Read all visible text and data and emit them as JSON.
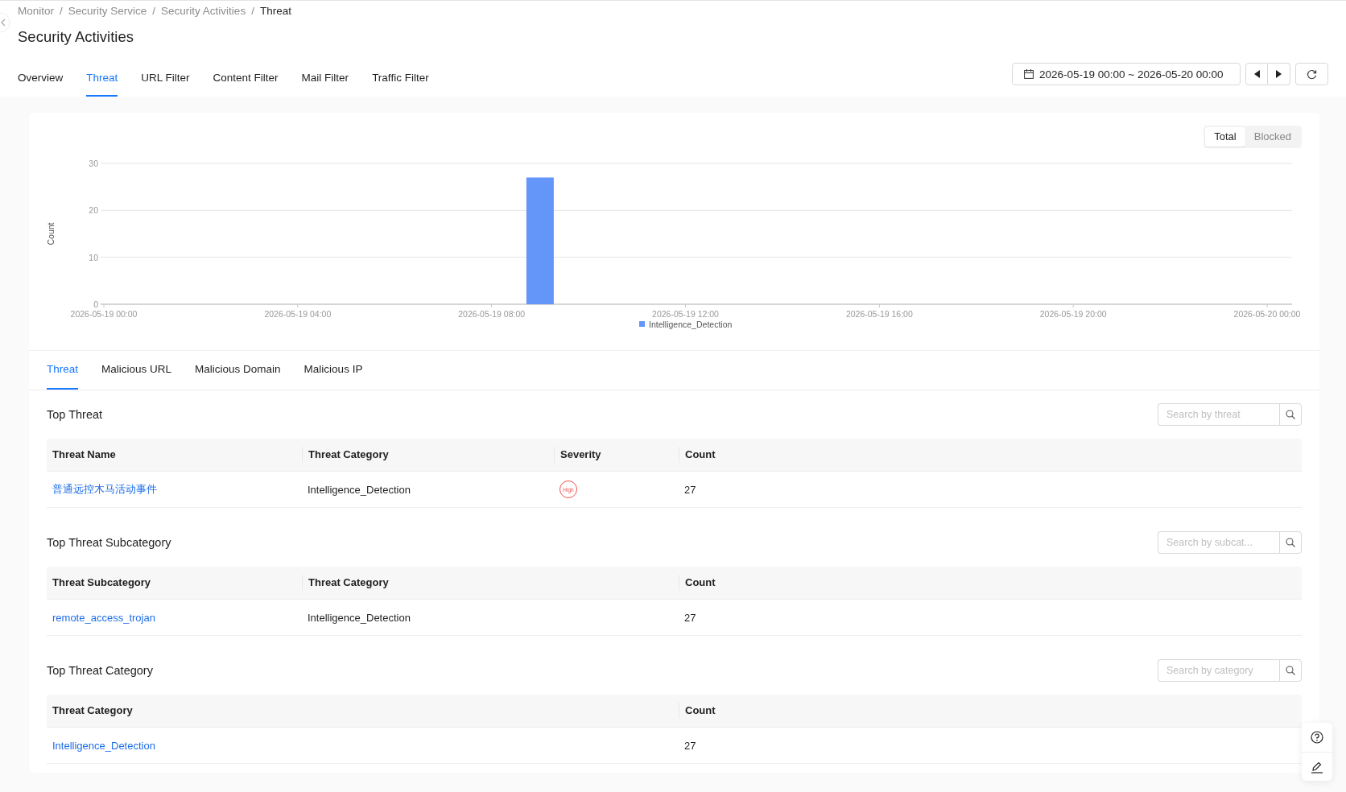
{
  "breadcrumb": {
    "separator": "/",
    "items": [
      {
        "label": "Monitor",
        "current": false
      },
      {
        "label": "Security Service",
        "current": false
      },
      {
        "label": "Security Activities",
        "current": false
      },
      {
        "label": "Threat",
        "current": true
      }
    ]
  },
  "title": "Security Activities",
  "tabs": [
    {
      "label": "Overview",
      "selected": false
    },
    {
      "label": "Threat",
      "selected": true
    },
    {
      "label": "URL Filter",
      "selected": false
    },
    {
      "label": "Content Filter",
      "selected": false
    },
    {
      "label": "Mail Filter",
      "selected": false
    },
    {
      "label": "Traffic Filter",
      "selected": false
    }
  ],
  "date_range": "2026-05-19 00:00 ~ 2026-05-20 00:00",
  "chart": {
    "toggle": [
      {
        "label": "Total",
        "selected": true
      },
      {
        "label": "Blocked",
        "selected": false
      }
    ],
    "chart_data": {
      "type": "bar",
      "ylabel": "Count",
      "categories": [
        "2026-05-19 00:00",
        null,
        null,
        null,
        "2026-05-19 04:00",
        null,
        null,
        null,
        "2026-05-19 08:00",
        null,
        null,
        null,
        "2026-05-19 12:00",
        null,
        null,
        null,
        "2026-05-19 16:00",
        null,
        null,
        null,
        "2026-05-19 20:00",
        null,
        null,
        null,
        "2026-05-20 00:00"
      ],
      "series": [
        {
          "name": "Intelligence_Detection",
          "color": "#6495f9",
          "values": [
            0,
            0,
            0,
            0,
            0,
            0,
            0,
            0,
            0,
            27,
            0,
            0,
            0,
            0,
            0,
            0,
            0,
            0,
            0,
            0,
            0,
            0,
            0,
            0,
            0
          ]
        }
      ],
      "ylim": [
        0,
        30
      ],
      "yticks": [
        0,
        10,
        20,
        30
      ]
    }
  },
  "sub_tabs": [
    {
      "label": "Threat",
      "selected": true
    },
    {
      "label": "Malicious URL",
      "selected": false
    },
    {
      "label": "Malicious Domain",
      "selected": false
    },
    {
      "label": "Malicious IP",
      "selected": false
    }
  ],
  "sections": [
    {
      "title": "Top Threat",
      "search": {
        "placeholder": "Search by threat"
      },
      "columns": [
        "Threat Name",
        "Threat Category",
        "Severity",
        "Count"
      ],
      "rows": [
        [
          {
            "kind": "link",
            "text": "普通远控木马活动事件"
          },
          {
            "kind": "text",
            "text": "Intelligence_Detection"
          },
          {
            "kind": "badge",
            "text": "High"
          },
          {
            "kind": "text",
            "text": "27"
          }
        ]
      ]
    },
    {
      "title": "Top Threat Subcategory",
      "search": {
        "placeholder": "Search by subcat..."
      },
      "columns": [
        "Threat Subcategory",
        "Threat Category",
        "Count"
      ],
      "rows": [
        [
          {
            "kind": "link",
            "text": "remote_access_trojan"
          },
          {
            "kind": "text",
            "text": "Intelligence_Detection"
          },
          {
            "kind": "text",
            "text": "27"
          }
        ]
      ]
    },
    {
      "title": "Top Threat Category",
      "search": {
        "placeholder": "Search by category"
      },
      "columns": [
        "Threat Category",
        "Count"
      ],
      "rows": [
        [
          {
            "kind": "link",
            "text": "Intelligence_Detection"
          },
          {
            "kind": "text",
            "text": "27"
          }
        ]
      ]
    }
  ]
}
